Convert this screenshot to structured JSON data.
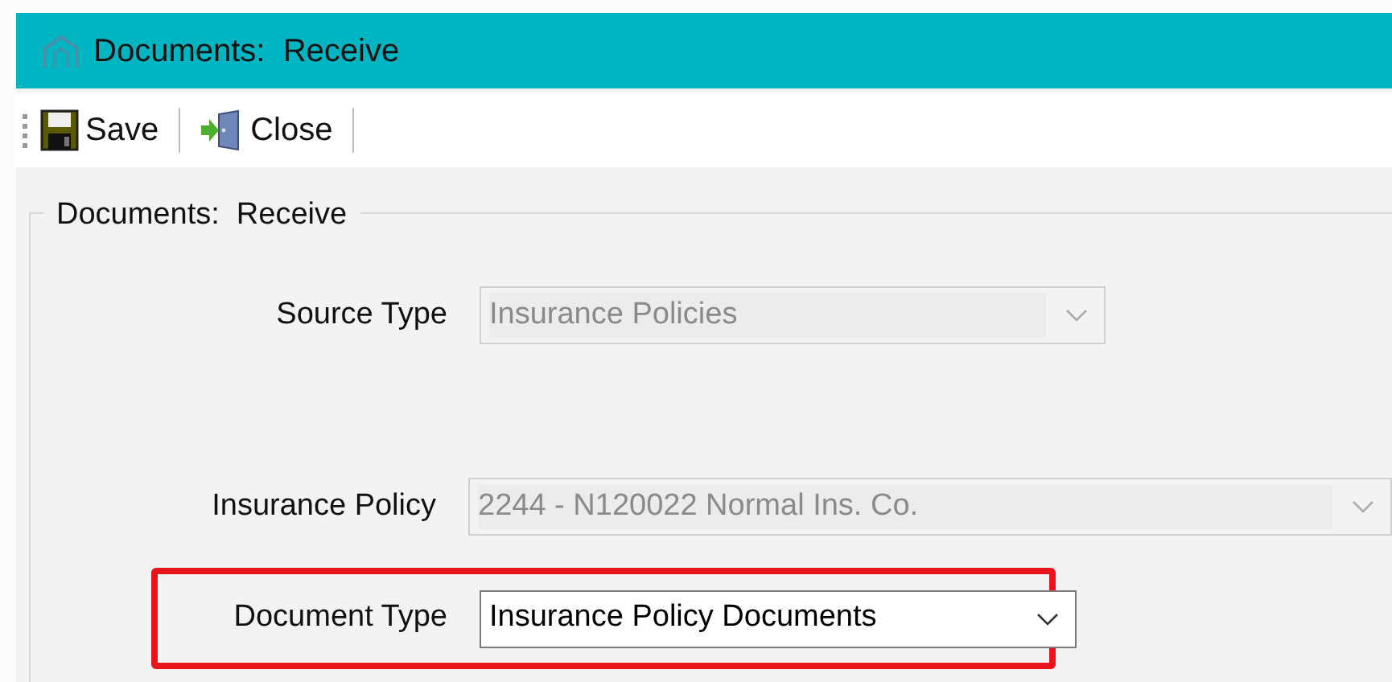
{
  "window": {
    "title": "Documents:  Receive"
  },
  "toolbar": [
    {
      "kind": "save",
      "label": "Save"
    },
    {
      "kind": "close",
      "label": "Close"
    }
  ],
  "group": {
    "title": "Documents:  Receive"
  },
  "fields": [
    {
      "label": "Source Type",
      "value": "Insurance Policies",
      "disabled": true,
      "highlighted": false
    },
    {
      "label": "Insurance Policy",
      "value": "2244 - N120022 Normal Ins. Co.",
      "disabled": true,
      "highlighted": false
    },
    {
      "label": "Document Type",
      "value": "Insurance Policy Documents",
      "disabled": false,
      "highlighted": true
    }
  ]
}
